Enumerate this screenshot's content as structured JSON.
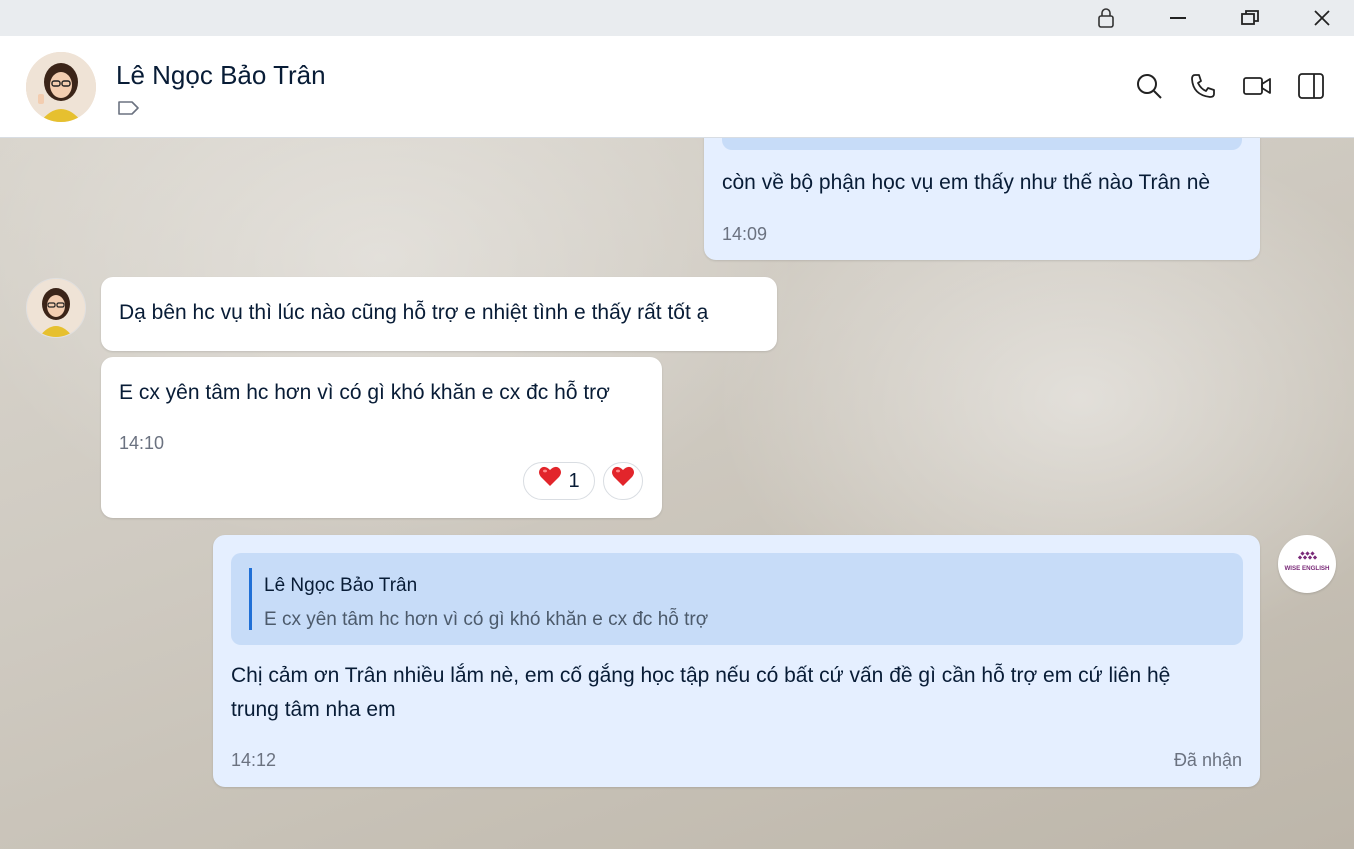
{
  "contact": {
    "name": "Lê Ngọc Bảo Trân"
  },
  "messages": {
    "m1": {
      "text": "còn về bộ phận học vụ em thấy như thế nào Trân nè",
      "time": "14:09"
    },
    "m2": {
      "text": "Dạ bên hc vụ thì lúc nào cũng hỗ trợ e nhiệt tình e thấy rất tốt ạ"
    },
    "m3": {
      "text": "E cx yên tâm hc hơn vì có gì khó khăn e cx đc hỗ trợ",
      "time": "14:10",
      "reaction_count": "1"
    },
    "m4": {
      "quote_name": "Lê Ngọc Bảo Trân",
      "quote_text": "E cx yên tâm hc hơn vì có gì khó khăn e cx đc hỗ trợ",
      "text_line1": "Chị cảm ơn Trân nhiều lắm nè, em cố gắng học tập nếu có bất cứ vấn đề gì cần hỗ trợ em cứ liên hệ",
      "text_line2": "trung tâm nha em",
      "time": "14:12",
      "status": "Đã nhận"
    }
  },
  "logo": {
    "text": "WISE ENGLISH"
  },
  "colors": {
    "outgoing_bubble": "#e5efff",
    "incoming_bubble": "#ffffff",
    "quote_bg": "#c7dcf8",
    "accent": "#1f6fd6",
    "logo_purple": "#7a2a78"
  },
  "icons": [
    "lock-icon",
    "minimize-icon",
    "restore-icon",
    "close-icon",
    "tag-icon",
    "search-icon",
    "phone-icon",
    "video-icon",
    "sidebar-toggle-icon",
    "heart-icon"
  ]
}
